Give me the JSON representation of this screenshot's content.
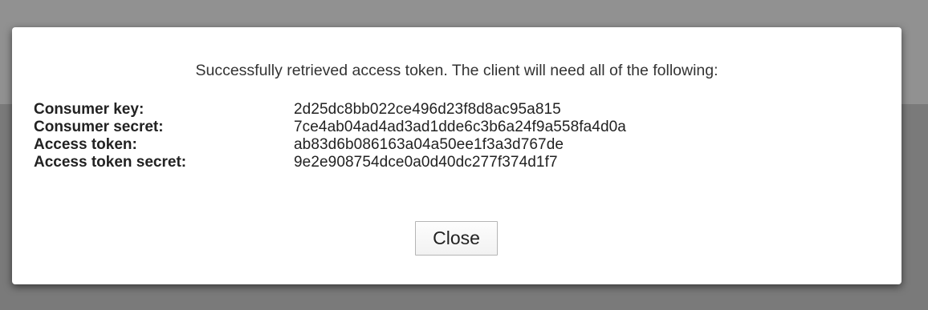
{
  "dialog": {
    "message": "Successfully retrieved access token. The client will need all of the following:",
    "credentials": [
      {
        "label": "Consumer key:",
        "value": "2d25dc8bb022ce496d23f8d8ac95a815"
      },
      {
        "label": "Consumer secret:",
        "value": "7ce4ab04ad4ad3ad1dde6c3b6a24f9a558fa4d0a"
      },
      {
        "label": "Access token:",
        "value": "ab83d6b086163a04a50ee1f3a3d767de"
      },
      {
        "label": "Access token secret:",
        "value": "9e2e908754dce0a0d40dc277f374d1f7"
      }
    ],
    "close_label": "Close"
  },
  "colors": {
    "backdrop_top": "#919191",
    "backdrop_bottom": "#7a7a7a",
    "dialog_background": "#ffffff",
    "text": "#333333"
  }
}
